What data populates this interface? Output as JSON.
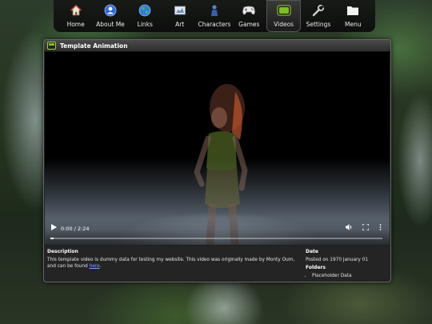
{
  "nav": {
    "items": [
      {
        "label": "Home",
        "icon": "home-icon"
      },
      {
        "label": "About Me",
        "icon": "about-icon"
      },
      {
        "label": "Links",
        "icon": "globe-icon"
      },
      {
        "label": "Art",
        "icon": "art-icon"
      },
      {
        "label": "Characters",
        "icon": "character-icon"
      },
      {
        "label": "Games",
        "icon": "gamepad-icon"
      },
      {
        "label": "Videos",
        "icon": "tv-icon"
      },
      {
        "label": "Settings",
        "icon": "wrench-icon"
      },
      {
        "label": "Menu",
        "icon": "folder-icon"
      }
    ],
    "active": "Videos"
  },
  "window": {
    "title": "Template Animation"
  },
  "player": {
    "time": "0:00 / 2:24",
    "progress": 0.0
  },
  "info": {
    "description_heading": "Description",
    "description_text": "This template video is dummy data for testing my website. This video was originally made by Monty Oum, and can be found ",
    "description_link": "here",
    "description_tail": ".",
    "date_heading": "Date",
    "date_text": "Posted on 1970 January 01",
    "folders_heading": "Folders",
    "folders": [
      "Placeholder Data"
    ]
  },
  "colors": {
    "accent": "#7cbf1e",
    "link": "#6fa8ff",
    "window_bg": "#1e1e1e"
  }
}
